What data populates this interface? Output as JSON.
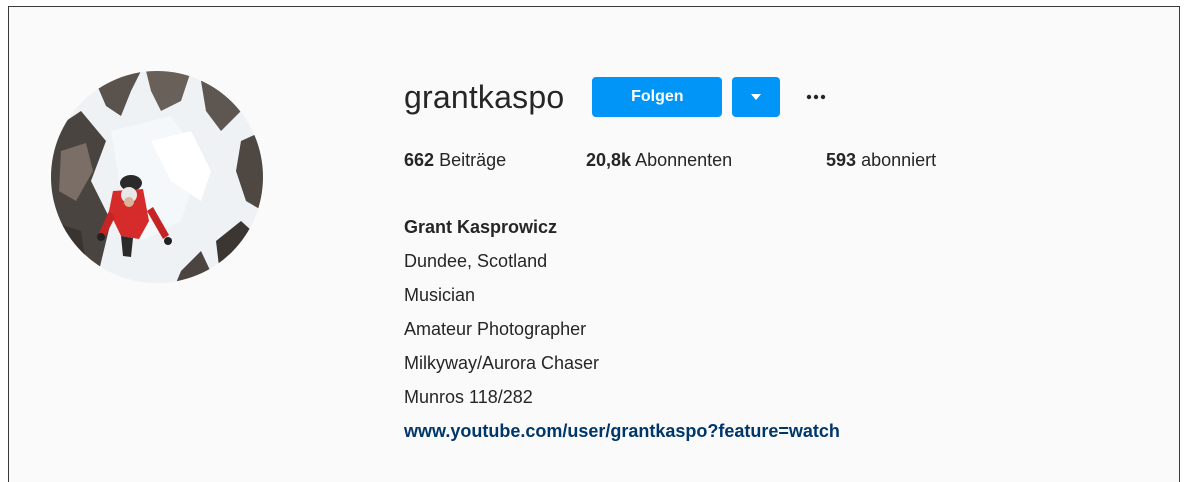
{
  "profile": {
    "username": "grantkaspo",
    "follow_label": "Folgen",
    "more_label": "···",
    "stats": {
      "posts_count": "662",
      "posts_label": "Beiträge",
      "followers_count": "20,8k",
      "followers_label": "Abonnenten",
      "following_count": "593",
      "following_label": "abonniert"
    },
    "bio": {
      "full_name": "Grant Kasprowicz",
      "lines": [
        "Dundee, Scotland",
        "Musician",
        "Amateur Photographer",
        "Milkyway/Aurora Chaser",
        "Munros 118/282"
      ],
      "link": "www.youtube.com/user/grantkaspo?feature=watch"
    }
  },
  "colors": {
    "accent": "#0095f6",
    "link": "#00376b",
    "text": "#262626",
    "background": "#fafafa"
  },
  "icons": {
    "dropdown": "caret-down-icon",
    "more": "more-dots-icon"
  }
}
